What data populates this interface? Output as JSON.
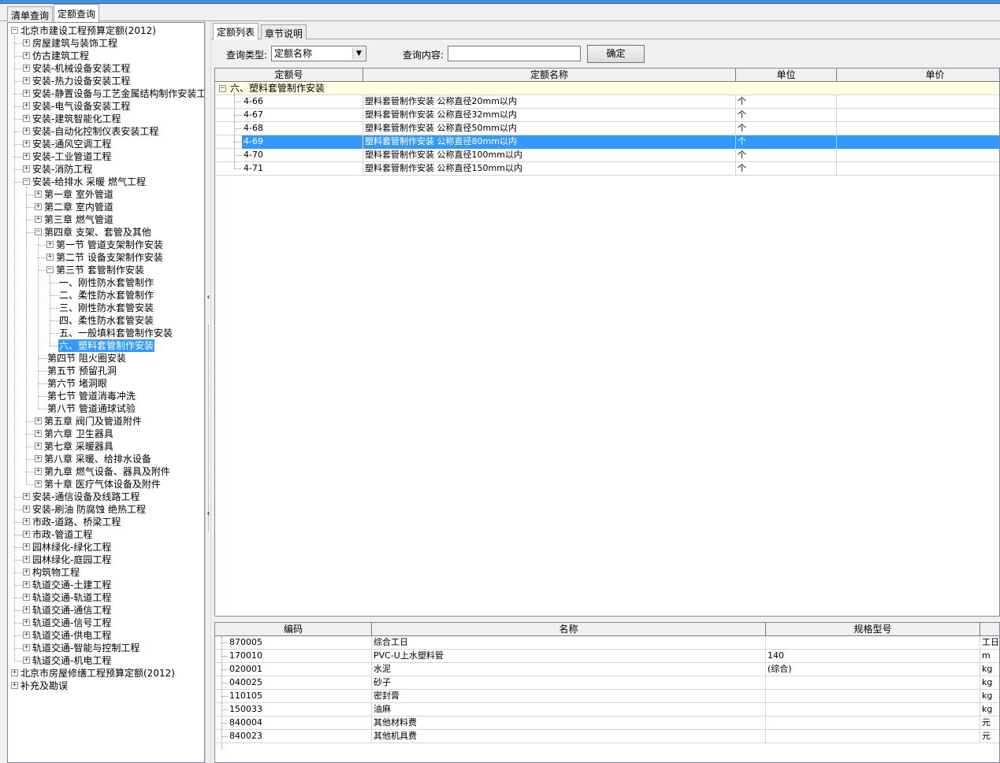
{
  "top_tabs": [
    {
      "label": "清单查询"
    },
    {
      "label": "定额查询"
    }
  ],
  "tree": {
    "items": [
      {
        "label": "北京市建设工程预算定额(2012)",
        "level": 0,
        "state": "open"
      },
      {
        "label": "房屋建筑与装饰工程",
        "level": 1,
        "state": "closed"
      },
      {
        "label": "仿古建筑工程",
        "level": 1,
        "state": "closed"
      },
      {
        "label": "安装-机械设备安装工程",
        "level": 1,
        "state": "closed"
      },
      {
        "label": "安装-热力设备安装工程",
        "level": 1,
        "state": "closed"
      },
      {
        "label": "安装-静置设备与工艺金属结构制作安装工",
        "level": 1,
        "state": "closed"
      },
      {
        "label": "安装-电气设备安装工程",
        "level": 1,
        "state": "closed"
      },
      {
        "label": "安装-建筑智能化工程",
        "level": 1,
        "state": "closed"
      },
      {
        "label": "安装-自动化控制仪表安装工程",
        "level": 1,
        "state": "closed"
      },
      {
        "label": "安装-通风空调工程",
        "level": 1,
        "state": "closed"
      },
      {
        "label": "安装-工业管道工程",
        "level": 1,
        "state": "closed"
      },
      {
        "label": "安装-消防工程",
        "level": 1,
        "state": "closed"
      },
      {
        "label": "安装-给排水 采暖 燃气工程",
        "level": 1,
        "state": "open"
      },
      {
        "label": "第一章 室外管道",
        "level": 2,
        "state": "closed"
      },
      {
        "label": "第二章 室内管道",
        "level": 2,
        "state": "closed"
      },
      {
        "label": "第三章 燃气管道",
        "level": 2,
        "state": "closed"
      },
      {
        "label": "第四章 支架、套管及其他",
        "level": 2,
        "state": "open"
      },
      {
        "label": "第一节 管道支架制作安装",
        "level": 3,
        "state": "closed"
      },
      {
        "label": "第二节 设备支架制作安装",
        "level": 3,
        "state": "closed"
      },
      {
        "label": "第三节 套管制作安装",
        "level": 3,
        "state": "open"
      },
      {
        "label": "一、刚性防水套管制作",
        "level": 4,
        "state": "leaf"
      },
      {
        "label": "二、柔性防水套管制作",
        "level": 4,
        "state": "leaf"
      },
      {
        "label": "三、刚性防水套管安装",
        "level": 4,
        "state": "leaf"
      },
      {
        "label": "四、柔性防水套管安装",
        "level": 4,
        "state": "leaf"
      },
      {
        "label": "五、一般填料套管制作安装",
        "level": 4,
        "state": "leaf"
      },
      {
        "label": "六、塑料套管制作安装",
        "level": 4,
        "state": "leaf",
        "selected": true
      },
      {
        "label": "第四节 阻火圈安装",
        "level": 3,
        "state": "leaf"
      },
      {
        "label": "第五节 预留孔洞",
        "level": 3,
        "state": "leaf"
      },
      {
        "label": "第六节 堵洞眼",
        "level": 3,
        "state": "leaf"
      },
      {
        "label": "第七节 管道消毒冲洗",
        "level": 3,
        "state": "leaf"
      },
      {
        "label": "第八节 管道通球试验",
        "level": 3,
        "state": "leaf"
      },
      {
        "label": "第五章 阀门及管道附件",
        "level": 2,
        "state": "closed"
      },
      {
        "label": "第六章 卫生器具",
        "level": 2,
        "state": "closed"
      },
      {
        "label": "第七章 采暖器具",
        "level": 2,
        "state": "closed"
      },
      {
        "label": "第八章 采暖、给排水设备",
        "level": 2,
        "state": "closed"
      },
      {
        "label": "第九章 燃气设备、器具及附件",
        "level": 2,
        "state": "closed"
      },
      {
        "label": "第十章 医疗气体设备及附件",
        "level": 2,
        "state": "closed"
      },
      {
        "label": "安装-通信设备及线路工程",
        "level": 1,
        "state": "closed"
      },
      {
        "label": "安装-刷油 防腐蚀 绝热工程",
        "level": 1,
        "state": "closed"
      },
      {
        "label": "市政-道路、桥梁工程",
        "level": 1,
        "state": "closed"
      },
      {
        "label": "市政-管道工程",
        "level": 1,
        "state": "closed"
      },
      {
        "label": "园林绿化-绿化工程",
        "level": 1,
        "state": "closed"
      },
      {
        "label": "园林绿化-庭园工程",
        "level": 1,
        "state": "closed"
      },
      {
        "label": "构筑物工程",
        "level": 1,
        "state": "closed"
      },
      {
        "label": "轨道交通-土建工程",
        "level": 1,
        "state": "closed"
      },
      {
        "label": "轨道交通-轨道工程",
        "level": 1,
        "state": "closed"
      },
      {
        "label": "轨道交通-通信工程",
        "level": 1,
        "state": "closed"
      },
      {
        "label": "轨道交通-信号工程",
        "level": 1,
        "state": "closed"
      },
      {
        "label": "轨道交通-供电工程",
        "level": 1,
        "state": "closed"
      },
      {
        "label": "轨道交通-智能与控制工程",
        "level": 1,
        "state": "closed"
      },
      {
        "label": "轨道交通-机电工程",
        "level": 1,
        "state": "closed"
      },
      {
        "label": "北京市房屋修缮工程预算定额(2012)",
        "level": 0,
        "state": "closed"
      },
      {
        "label": "补充及勘误",
        "level": 0,
        "state": "closed"
      }
    ]
  },
  "sub_tabs": [
    {
      "label": "定额列表"
    },
    {
      "label": "章节说明"
    }
  ],
  "query": {
    "type_label": "查询类型:",
    "type_value": "定额名称",
    "content_label": "查询内容:",
    "content_value": "",
    "confirm_label": "确定"
  },
  "quota_table": {
    "columns": [
      "定额号",
      "定额名称",
      "单位",
      "单价"
    ],
    "group": "六、塑料套管制作安装",
    "rows": [
      {
        "code": "4-66",
        "name": "塑料套管制作安装 公称直径20mm以内",
        "unit": "个",
        "price": ""
      },
      {
        "code": "4-67",
        "name": "塑料套管制作安装 公称直径32mm以内",
        "unit": "个",
        "price": ""
      },
      {
        "code": "4-68",
        "name": "塑料套管制作安装 公称直径50mm以内",
        "unit": "个",
        "price": ""
      },
      {
        "code": "4-69",
        "name": "塑料套管制作安装 公称直径80mm以内",
        "unit": "个",
        "price": "",
        "selected": true
      },
      {
        "code": "4-70",
        "name": "塑料套管制作安装 公称直径100mm以内",
        "unit": "个",
        "price": ""
      },
      {
        "code": "4-71",
        "name": "塑料套管制作安装 公称直径150mm以内",
        "unit": "个",
        "price": ""
      }
    ]
  },
  "material_table": {
    "columns": [
      "编码",
      "名称",
      "规格型号",
      ""
    ],
    "rows": [
      {
        "code": "870005",
        "name": "综合工日",
        "spec": "",
        "unit": "工日"
      },
      {
        "code": "170010",
        "name": "PVC-U上水塑料管",
        "spec": "140",
        "unit": "m"
      },
      {
        "code": "020001",
        "name": "水泥",
        "spec": "(综合)",
        "unit": "kg"
      },
      {
        "code": "040025",
        "name": "砂子",
        "spec": "",
        "unit": "kg"
      },
      {
        "code": "110105",
        "name": "密封膏",
        "spec": "",
        "unit": "kg"
      },
      {
        "code": "150033",
        "name": "油麻",
        "spec": "",
        "unit": "kg"
      },
      {
        "code": "840004",
        "name": "其他材料费",
        "spec": "",
        "unit": "元"
      },
      {
        "code": "840023",
        "name": "其他机具费",
        "spec": "",
        "unit": "元"
      }
    ]
  }
}
